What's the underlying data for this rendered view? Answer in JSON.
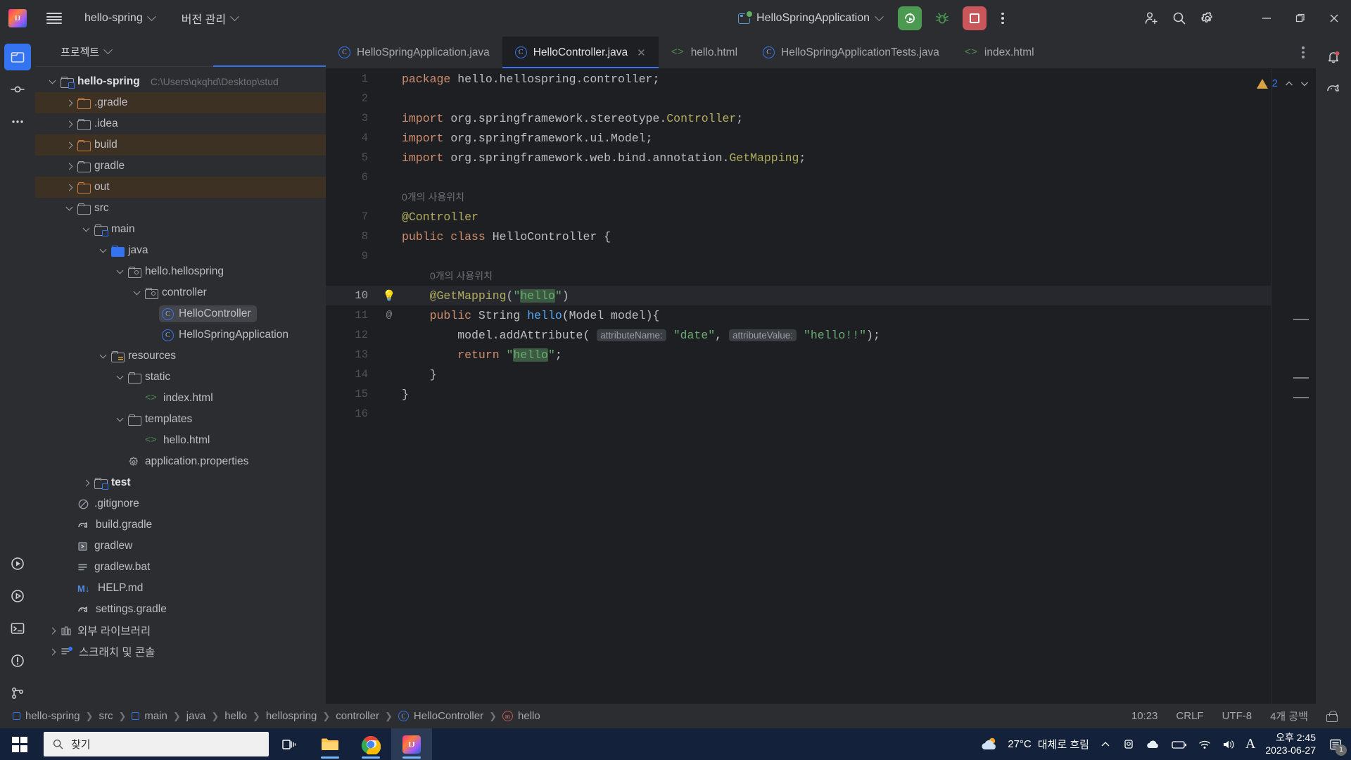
{
  "titlebar": {
    "logo": "intellij-idea-logo",
    "menu_icon": "hamburger-menu-icon",
    "project_name": "hello-spring",
    "vcs_label": "버전 관리",
    "run_config": "HelloSpringApplication",
    "run_button": "run-button",
    "debug_button": "debug-button",
    "stop_button": "stop-button",
    "more_button": "more-options-icon",
    "add_user": "add-user-icon",
    "search": "search-icon",
    "settings": "gear-icon",
    "minimize": "–",
    "maximize": "maximize-icon",
    "close": "close-icon"
  },
  "project_panel": {
    "title": "프로젝트",
    "tree": [
      {
        "label": "hello-spring",
        "path": "C:\\Users\\qkqhd\\Desktop\\stud",
        "indent": 0,
        "arrow": "down",
        "icon": "module-folder",
        "bold": true,
        "state": "normal"
      },
      {
        "label": ".gradle",
        "indent": 1,
        "arrow": "right",
        "icon": "folder-orange",
        "state": "excluded"
      },
      {
        "label": ".idea",
        "indent": 1,
        "arrow": "right",
        "icon": "folder",
        "state": "normal"
      },
      {
        "label": "build",
        "indent": 1,
        "arrow": "right",
        "icon": "folder-orange",
        "state": "excluded"
      },
      {
        "label": "gradle",
        "indent": 1,
        "arrow": "right",
        "icon": "folder",
        "state": "normal"
      },
      {
        "label": "out",
        "indent": 1,
        "arrow": "right",
        "icon": "folder-orange",
        "state": "excluded"
      },
      {
        "label": "src",
        "indent": 1,
        "arrow": "down",
        "icon": "folder",
        "state": "normal"
      },
      {
        "label": "main",
        "indent": 2,
        "arrow": "down",
        "icon": "module-folder",
        "state": "normal"
      },
      {
        "label": "java",
        "indent": 3,
        "arrow": "down",
        "icon": "folder-source",
        "state": "normal"
      },
      {
        "label": "hello.hellospring",
        "indent": 4,
        "arrow": "down",
        "icon": "package",
        "state": "normal"
      },
      {
        "label": "controller",
        "indent": 5,
        "arrow": "down",
        "icon": "package",
        "state": "normal"
      },
      {
        "label": "HelloController",
        "indent": 6,
        "arrow": "none",
        "icon": "java-class",
        "state": "selected"
      },
      {
        "label": "HelloSpringApplication",
        "indent": 6,
        "arrow": "none",
        "icon": "java-class",
        "state": "normal"
      },
      {
        "label": "resources",
        "indent": 3,
        "arrow": "down",
        "icon": "folder-resource",
        "state": "normal"
      },
      {
        "label": "static",
        "indent": 4,
        "arrow": "down",
        "icon": "folder",
        "state": "normal"
      },
      {
        "label": "index.html",
        "indent": 5,
        "arrow": "none",
        "icon": "html-file",
        "state": "normal"
      },
      {
        "label": "templates",
        "indent": 4,
        "arrow": "down",
        "icon": "folder",
        "state": "normal"
      },
      {
        "label": "hello.html",
        "indent": 5,
        "arrow": "none",
        "icon": "html-file",
        "state": "normal"
      },
      {
        "label": "application.properties",
        "indent": 4,
        "arrow": "none",
        "icon": "properties-file",
        "state": "normal"
      },
      {
        "label": "test",
        "indent": 2,
        "arrow": "right",
        "icon": "module-folder",
        "bold": true,
        "state": "normal"
      },
      {
        "label": ".gitignore",
        "indent": 1,
        "arrow": "none",
        "icon": "gitignore-file",
        "state": "normal"
      },
      {
        "label": "build.gradle",
        "indent": 1,
        "arrow": "none",
        "icon": "gradle-file",
        "state": "normal"
      },
      {
        "label": "gradlew",
        "indent": 1,
        "arrow": "none",
        "icon": "script-file",
        "state": "normal"
      },
      {
        "label": "gradlew.bat",
        "indent": 1,
        "arrow": "none",
        "icon": "text-file",
        "state": "normal"
      },
      {
        "label": "HELP.md",
        "indent": 1,
        "arrow": "none",
        "icon": "markdown-file",
        "state": "normal"
      },
      {
        "label": "settings.gradle",
        "indent": 1,
        "arrow": "none",
        "icon": "gradle-file",
        "state": "normal"
      },
      {
        "label": "외부 라이브러리",
        "indent": 0,
        "arrow": "right",
        "icon": "library-icon",
        "state": "normal"
      },
      {
        "label": "스크래치 및 콘솔",
        "indent": 0,
        "arrow": "right",
        "icon": "scratch-icon",
        "state": "normal"
      }
    ]
  },
  "editor": {
    "tabs": [
      {
        "label": "HelloSpringApplication.java",
        "icon": "java-class-icon",
        "active": false,
        "closable": false
      },
      {
        "label": "HelloController.java",
        "icon": "java-class-icon",
        "active": true,
        "closable": true
      },
      {
        "label": "hello.html",
        "icon": "html-file-icon",
        "active": false,
        "closable": false
      },
      {
        "label": "HelloSpringApplicationTests.java",
        "icon": "java-class-icon",
        "active": false,
        "closable": false
      },
      {
        "label": "index.html",
        "icon": "html-file-icon",
        "active": false,
        "closable": false
      }
    ],
    "close_glyph": "✕",
    "warning_count": "2",
    "warning_up": "prev-problem-icon",
    "warning_down": "next-problem-icon",
    "lines": [
      {
        "num": "1",
        "tokens": [
          {
            "t": "package ",
            "c": "kw"
          },
          {
            "t": "hello.hellospring.controller;",
            "c": "cls"
          }
        ]
      },
      {
        "num": "2",
        "tokens": []
      },
      {
        "num": "3",
        "tokens": [
          {
            "t": "import ",
            "c": "kw"
          },
          {
            "t": "org.springframework.stereotype.",
            "c": "cls"
          },
          {
            "t": "Controller",
            "c": "ann"
          },
          {
            "t": ";",
            "c": "cls"
          }
        ]
      },
      {
        "num": "4",
        "tokens": [
          {
            "t": "import ",
            "c": "kw"
          },
          {
            "t": "org.springframework.ui.Model;",
            "c": "cls"
          }
        ]
      },
      {
        "num": "5",
        "tokens": [
          {
            "t": "import ",
            "c": "kw"
          },
          {
            "t": "org.springframework.web.bind.annotation.",
            "c": "cls"
          },
          {
            "t": "GetMapping",
            "c": "ann"
          },
          {
            "t": ";",
            "c": "cls"
          }
        ]
      },
      {
        "num": "6",
        "tokens": []
      },
      {
        "num": "",
        "inlay": "0개의 사용위치",
        "inlay_indent": 0
      },
      {
        "num": "7",
        "tokens": [
          {
            "t": "@Controller",
            "c": "ann"
          }
        ]
      },
      {
        "num": "8",
        "tokens": [
          {
            "t": "public class ",
            "c": "kw"
          },
          {
            "t": "HelloController ",
            "c": "cls"
          },
          {
            "t": "{",
            "c": "cls"
          }
        ]
      },
      {
        "num": "9",
        "tokens": []
      },
      {
        "num": "",
        "inlay": "0개의 사용위치",
        "inlay_indent": 1
      },
      {
        "num": "10",
        "current": true,
        "bulb": true,
        "tokens": [
          {
            "t": "    ",
            "c": "cls"
          },
          {
            "t": "@GetMapping",
            "c": "ann"
          },
          {
            "t": "(",
            "c": "cls"
          },
          {
            "t": "\"",
            "c": "str"
          },
          {
            "t": "hello",
            "c": "str hl"
          },
          {
            "t": "\"",
            "c": "str"
          },
          {
            "t": ")",
            "c": "cls"
          }
        ]
      },
      {
        "num": "11",
        "gutter": "@",
        "tokens": [
          {
            "t": "    ",
            "c": "cls"
          },
          {
            "t": "public ",
            "c": "kw"
          },
          {
            "t": "String ",
            "c": "cls"
          },
          {
            "t": "hello",
            "c": "mth"
          },
          {
            "t": "(Model model){",
            "c": "cls"
          }
        ]
      },
      {
        "num": "12",
        "tokens": [
          {
            "t": "        model.",
            "c": "cls"
          },
          {
            "t": "addAttribute",
            "c": "cls"
          },
          {
            "t": "( ",
            "c": "cls"
          },
          {
            "t": "attributeName:",
            "c": "phint"
          },
          {
            "t": " ",
            "c": "cls"
          },
          {
            "t": "\"date\"",
            "c": "str"
          },
          {
            "t": ", ",
            "c": "cls"
          },
          {
            "t": "attributeValue:",
            "c": "phint"
          },
          {
            "t": " ",
            "c": "cls"
          },
          {
            "t": "\"hello!!\"",
            "c": "str"
          },
          {
            "t": ");",
            "c": "cls"
          }
        ]
      },
      {
        "num": "13",
        "tokens": [
          {
            "t": "        ",
            "c": "cls"
          },
          {
            "t": "return ",
            "c": "kw"
          },
          {
            "t": "\"",
            "c": "str"
          },
          {
            "t": "hello",
            "c": "str hl"
          },
          {
            "t": "\"",
            "c": "str"
          },
          {
            "t": ";",
            "c": "cls"
          }
        ]
      },
      {
        "num": "14",
        "tokens": [
          {
            "t": "    }",
            "c": "cls"
          }
        ]
      },
      {
        "num": "15",
        "tokens": [
          {
            "t": "}",
            "c": "cls"
          }
        ]
      },
      {
        "num": "16",
        "tokens": []
      }
    ]
  },
  "breadcrumb": {
    "items": [
      {
        "label": "hello-spring",
        "icon": "module-square-icon"
      },
      {
        "label": "src",
        "icon": "none"
      },
      {
        "label": "main",
        "icon": "module-square-icon"
      },
      {
        "label": "java",
        "icon": "none"
      },
      {
        "label": "hello",
        "icon": "none"
      },
      {
        "label": "hellospring",
        "icon": "none"
      },
      {
        "label": "controller",
        "icon": "none"
      },
      {
        "label": "HelloController",
        "icon": "class-icon"
      },
      {
        "label": "hello",
        "icon": "method-icon"
      }
    ],
    "separator": "❯",
    "class_glyph": "C",
    "method_glyph": "m"
  },
  "statusbar": {
    "caret": "10:23",
    "line_sep": "CRLF",
    "encoding": "UTF-8",
    "indent": "4개 공백",
    "lock": "read-only-lock-icon"
  },
  "taskbar": {
    "start": "windows-start-icon",
    "search_placeholder": "찾기",
    "search_icon": "search-icon",
    "apps": [
      {
        "name": "task-view-icon"
      },
      {
        "name": "file-explorer-icon"
      },
      {
        "name": "chrome-icon"
      },
      {
        "name": "intellij-idea-icon"
      }
    ],
    "weather_temp": "27°C",
    "weather_desc": "대체로 흐림",
    "tray": [
      "chevron-up-icon",
      "webcam-icon",
      "onedrive-icon",
      "battery-icon",
      "wifi-icon",
      "volume-icon",
      "ime-icon"
    ],
    "ime_label": "A",
    "time": "오후 2:45",
    "date": "2023-06-27",
    "notification_count": "1"
  },
  "toolwindows": {
    "left": [
      "project-icon",
      "commit-icon",
      "more-tool-windows-icon",
      "run-icon",
      "debug-icon",
      "terminal-icon",
      "problems-icon",
      "git-icon"
    ],
    "right": [
      "notifications-icon",
      "gradle-icon"
    ]
  },
  "colors": {
    "accent": "#3574f0",
    "run_green": "#4c9952",
    "stop_red": "#c9565b",
    "excluded_bg": "#3c3123",
    "editor_bg": "#1e1f22",
    "panel_bg": "#2b2d30",
    "taskbar_bg": "#13213a"
  }
}
